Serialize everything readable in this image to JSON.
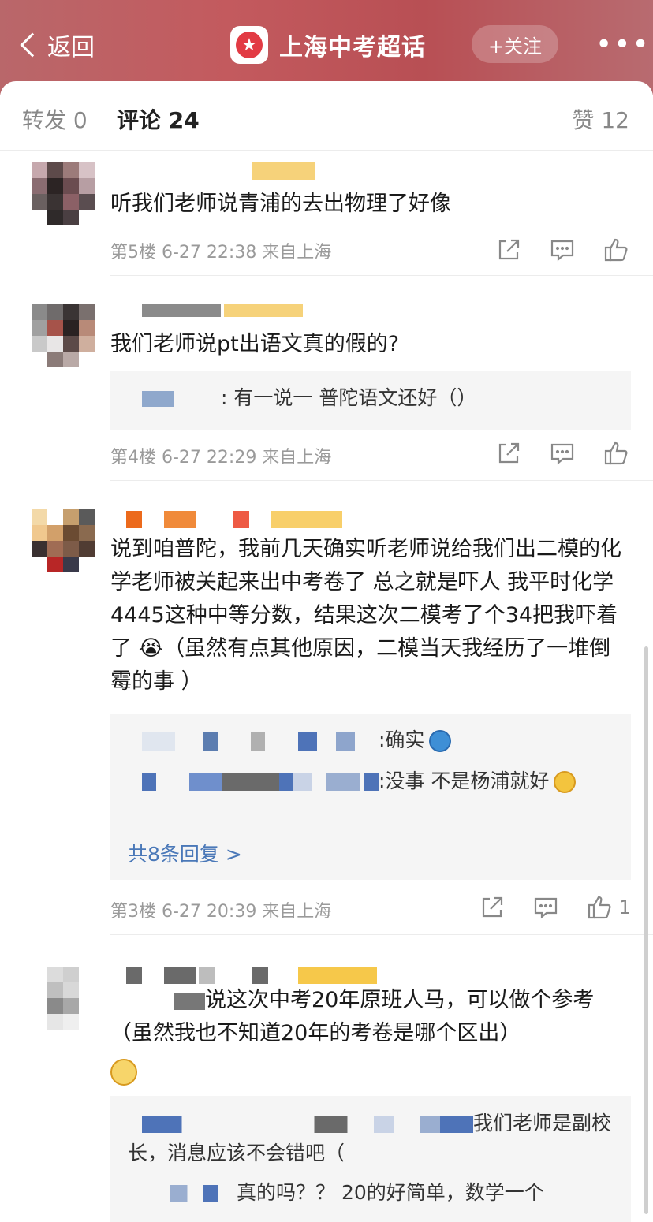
{
  "header": {
    "back_label": "返回",
    "title": "上海中考超话",
    "follow_label": "+关注",
    "more_label": "•••"
  },
  "tabs": {
    "repost": "转发 0",
    "comments": "评论 24",
    "likes": "赞 12"
  },
  "comments": [
    {
      "text": "听我们老师说青浦的去出物理了好像",
      "meta": "第5楼 6-27 22:38 来自上海",
      "like_count": ""
    },
    {
      "text": "我们老师说pt出语文真的假的?",
      "reply": ": 有一说一 普陀语文还好（）",
      "meta": "第4楼 6-27 22:29 来自上海",
      "like_count": ""
    },
    {
      "text": "说到咱普陀，我前几天确实听老师说给我们出二模的化学老师被关起来出中考卷了 总之就是吓人 我平时化学4445这种中等分数，结果这次二模考了个34把我吓着了 😭（虽然有点其他原因，二模当天我经历了一堆倒霉的事 ）",
      "replies": [
        ":确实",
        ":没事 不是杨浦就好"
      ],
      "more_replies": "共8条回复 >",
      "meta": "第3楼 6-27 20:39 来自上海",
      "like_count": "1"
    },
    {
      "text": "说这次中考20年原班人马，可以做个参考（虽然我也不知道20年的考卷是哪个区出）",
      "replies": [
        "我们老师是副校长，消息应该不会错吧（",
        "真的吗？？ 20的好简单，数学一个"
      ],
      "meta": "",
      "like_count": ""
    }
  ]
}
